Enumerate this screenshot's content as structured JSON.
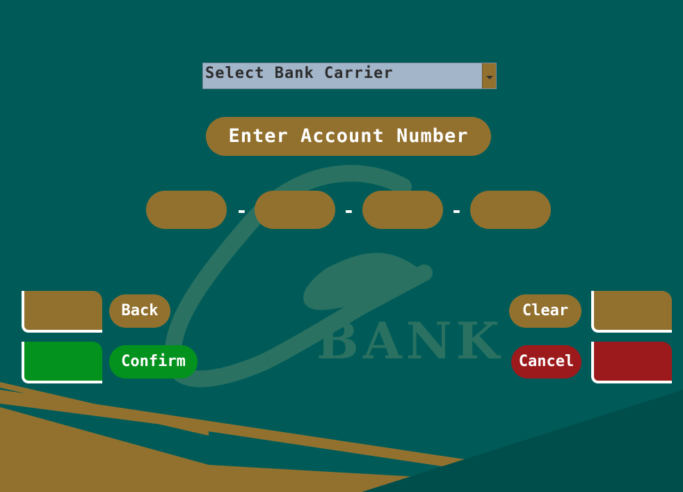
{
  "carrier_select": {
    "value": "Select Bank Carrier"
  },
  "title": "Enter Account Number",
  "separator": "-",
  "buttons": {
    "back": "Back",
    "confirm": "Confirm",
    "clear": "Clear",
    "cancel": "Cancel"
  },
  "logo": {
    "text": "BANK"
  },
  "colors": {
    "background": "#005b58",
    "accent_gold": "#92712f",
    "confirm_green": "#03921e",
    "cancel_red": "#9d1a1c",
    "select_bg": "#a3b5c9"
  }
}
